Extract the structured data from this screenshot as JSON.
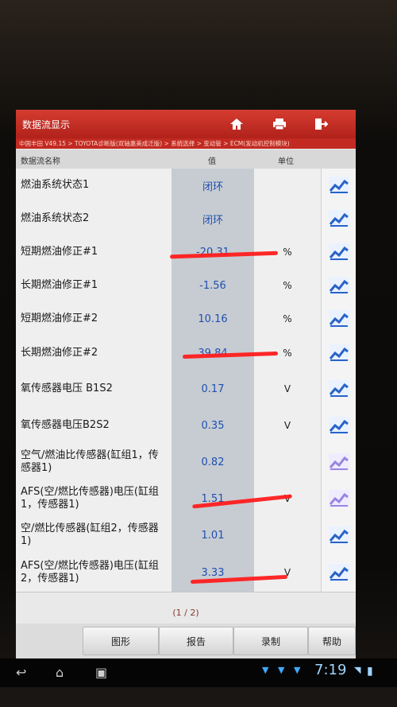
{
  "app": {
    "title": "数据流显示",
    "breadcrumb": "中国丰田 V49.15 > TOYOTA诊断版(双轴惠美成迁版) > 系统选择 > 变动管 > ECM(发动机控制模块)"
  },
  "toolbar": {
    "home_icon": "home-icon",
    "print_icon": "printer-icon",
    "exit_icon": "exit-icon"
  },
  "table": {
    "headers": {
      "name": "数据流名称",
      "value": "值",
      "unit": "单位"
    },
    "rows": [
      {
        "name": "燃油系统状态1",
        "value": "闭环",
        "unit": ""
      },
      {
        "name": "燃油系统状态2",
        "value": "闭环",
        "unit": ""
      },
      {
        "name": "短期燃油修正#1",
        "value": "-20.31",
        "unit": "%"
      },
      {
        "name": "长期燃油修正#1",
        "value": "-1.56",
        "unit": "%"
      },
      {
        "name": "短期燃油修正#2",
        "value": "10.16",
        "unit": "%"
      },
      {
        "name": "长期燃油修正#2",
        "value": "39.84",
        "unit": "%"
      },
      {
        "name": "氧传感器电压 B1S2",
        "value": "0.17",
        "unit": "V"
      },
      {
        "name": "氧传感器电压B2S2",
        "value": "0.35",
        "unit": "V"
      },
      {
        "name": "空气/燃油比传感器(缸组1，传感器1)",
        "value": "0.82",
        "unit": ""
      },
      {
        "name": "AFS(空/燃比传感器)电压(缸组1，传感器1)",
        "value": "1.51",
        "unit": "V"
      },
      {
        "name": "空/燃比传感器(缸组2，传感器1)",
        "value": "1.01",
        "unit": ""
      },
      {
        "name": "AFS(空/燃比传感器)电压(缸组2，传感器1)",
        "value": "3.33",
        "unit": "V"
      }
    ]
  },
  "pager": "(1 / 2)",
  "buttons": {
    "graph": "图形",
    "report": "报告",
    "record": "录制",
    "help": "帮助"
  },
  "statusbar": {
    "time": "7:19"
  },
  "colors": {
    "title_bar": "#c82a22",
    "value_text": "#1e4fb0",
    "annotation": "#ff1c1c"
  }
}
